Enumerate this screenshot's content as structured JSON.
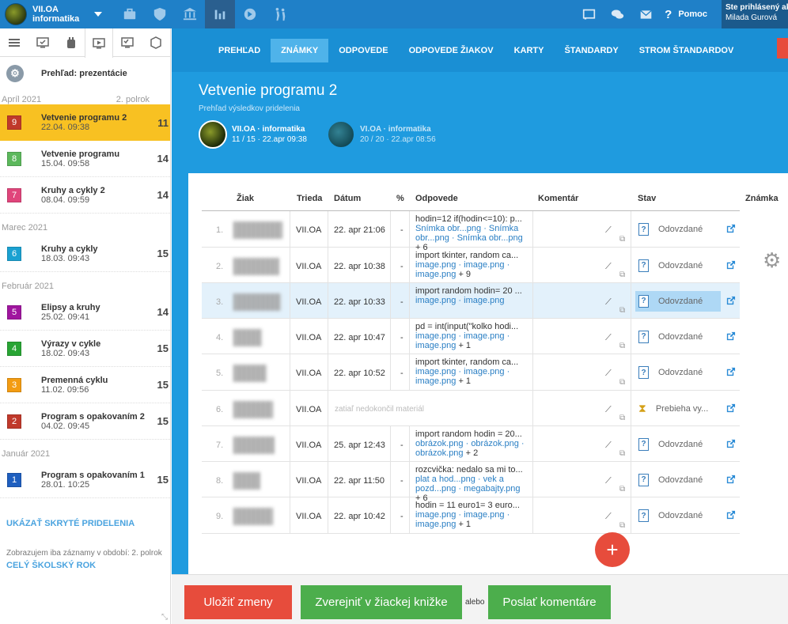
{
  "topbar": {
    "class_name": "VII.OA",
    "subject": "informatika",
    "help_label": "Pomoc",
    "user_line1": "Ste prihlásený ako",
    "user_line2": "Milada Gurová"
  },
  "sidebar": {
    "overview_label": "Prehľad: prezentácie",
    "period_label": "2. polrok",
    "months": [
      "Apríl 2021",
      "Marec 2021",
      "Február 2021",
      "Január 2021"
    ],
    "items": [
      {
        "num": "9",
        "color": "#c0392b",
        "title": "Vetvenie programu 2",
        "date": "22.04. 09:38",
        "count": "11"
      },
      {
        "num": "8",
        "color": "#5cb85c",
        "title": "Vetvenie programu",
        "date": "15.04. 09:58",
        "count": "14"
      },
      {
        "num": "7",
        "color": "#e0457b",
        "title": "Kruhy a cykly 2",
        "date": "08.04. 09:59",
        "count": "14"
      },
      {
        "num": "6",
        "color": "#1ba1d1",
        "title": "Kruhy a cykly",
        "date": "18.03. 09:43",
        "count": "15"
      },
      {
        "num": "5",
        "color": "#a0169f",
        "title": "Elipsy a kruhy",
        "date": "25.02. 09:41",
        "count": "14"
      },
      {
        "num": "4",
        "color": "#28a534",
        "title": "Výrazy v cykle",
        "date": "18.02. 09:43",
        "count": "15"
      },
      {
        "num": "3",
        "color": "#f39c12",
        "title": "Premenná cyklu",
        "date": "11.02. 09:56",
        "count": "15"
      },
      {
        "num": "2",
        "color": "#c0392b",
        "title": "Program s opakovaním 2",
        "date": "04.02. 09:45",
        "count": "15"
      },
      {
        "num": "1",
        "color": "#1f5fbf",
        "title": "Program s opakovaním 1",
        "date": "28.01. 10:25",
        "count": "15"
      }
    ],
    "show_hidden_label": "UKÁZAŤ SKRYTÉ PRIDELENIA",
    "note": "Zobrazujem iba záznamy v období: 2. polrok",
    "whole_year_label": "CELÝ ŠKOLSKÝ ROK"
  },
  "nav": {
    "tabs": [
      "PREHĽAD",
      "ZNÁMKY",
      "ODPOVEDE",
      "ODPOVEDE ŽIAKOV",
      "KARTY",
      "ŠTANDARDY",
      "STROM ŠTANDARDOV"
    ],
    "active": "ZNÁMKY"
  },
  "header": {
    "title": "Vetvenie programu 2",
    "subtitle": "Prehľad výsledkov pridelenia",
    "classes": [
      {
        "name": "VII.OA · informatika",
        "stats": "11 / 15 · 22.apr 09:38"
      },
      {
        "name": "VI.OA · informatika",
        "stats": "20 / 20 · 22.apr 08:56"
      }
    ]
  },
  "table": {
    "headers": {
      "student": "Žiak",
      "class": "Trieda",
      "date": "Dátum",
      "pct": "%",
      "answers": "Odpovede",
      "comment": "Komentár",
      "status": "Stav",
      "grade": "Známka"
    },
    "rows": [
      {
        "num": "1.",
        "class": "VII.OA",
        "date": "22. apr 21:06",
        "pct": "-",
        "answer": "hodin=12 if(hodin<=10): p...",
        "links": "Snímka obr...png · Snímka obr...png · Snímka obr...png",
        "more": "+ 6",
        "status": "Odovzdané"
      },
      {
        "num": "2.",
        "class": "VII.OA",
        "date": "22. apr 10:38",
        "pct": "-",
        "answer": "import tkinter, random ca...",
        "links": "image.png · image.png · image.png",
        "more": "+ 9",
        "status": "Odovzdané"
      },
      {
        "num": "3.",
        "class": "VII.OA",
        "date": "22. apr 10:33",
        "pct": "-",
        "answer": "import random hodin= 20 ...",
        "links": "image.png · image.png",
        "more": "",
        "status": "Odovzdané"
      },
      {
        "num": "4.",
        "class": "VII.OA",
        "date": "22. apr 10:47",
        "pct": "-",
        "answer": "pd = int(input(\"kolko hodi...",
        "links": "image.png · image.png · image.png",
        "more": "+ 1",
        "status": "Odovzdané"
      },
      {
        "num": "5.",
        "class": "VII.OA",
        "date": "22. apr 10:52",
        "pct": "-",
        "answer": "import tkinter, random ca...",
        "links": "image.png · image.png · image.png",
        "more": "+ 1",
        "status": "Odovzdané"
      },
      {
        "num": "6.",
        "class": "VII.OA",
        "date": "",
        "pct": "",
        "answer": "zatiaľ nedokončil materiál",
        "links": "",
        "more": "",
        "status": "Prebieha vy..."
      },
      {
        "num": "7.",
        "class": "VII.OA",
        "date": "25. apr 12:43",
        "pct": "-",
        "answer": "import random hodin = 20...",
        "links": "obrázok.png · obrázok.png · obrázok.png",
        "more": "+ 2",
        "status": "Odovzdané"
      },
      {
        "num": "8.",
        "class": "VII.OA",
        "date": "22. apr 11:50",
        "pct": "-",
        "answer": "rozcvička: nedalo sa mi to...",
        "links": "plat a hod...png · vek a pozd...png · megabajty.png",
        "more": "+ 6",
        "status": "Odovzdané"
      },
      {
        "num": "9.",
        "class": "VII.OA",
        "date": "22. apr 10:42",
        "pct": "-",
        "answer": "hodin = 11 euro1= 3 euro...",
        "links": "image.png · image.png · image.png",
        "more": "+ 1",
        "status": "Odovzdané"
      }
    ]
  },
  "footer": {
    "save_label": "Uložiť zmeny",
    "publish_label": "Zverejniť v žiackej knižke",
    "or_label": "alebo",
    "send_label": "Poslať komentáre"
  }
}
